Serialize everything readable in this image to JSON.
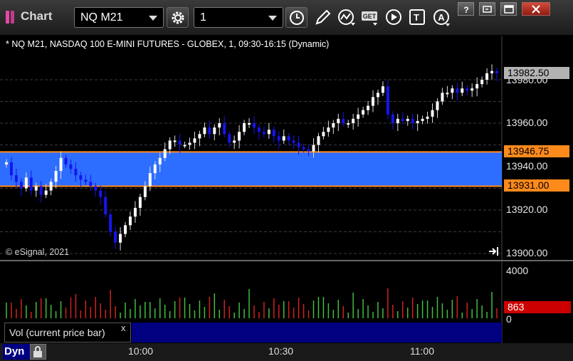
{
  "window": {
    "title": "Chart",
    "symbol": "NQ M21",
    "interval": "1"
  },
  "toolbar": {
    "icons": [
      "settings-gear-icon",
      "clock-icon",
      "pencil-icon",
      "studies-icon",
      "get-icon",
      "play-icon",
      "text-tool-icon",
      "alert-icon"
    ],
    "get_label": "GET",
    "text_tool_label": "T",
    "alert_label": "A"
  },
  "window_controls": [
    "help-icon",
    "restore-icon",
    "maximize-icon",
    "close-icon"
  ],
  "chart": {
    "header": "* NQ M21, NASDAQ 100 E-MINI FUTURES - GLOBEX, 1, 09:30-16:15 (Dynamic)",
    "copyright": "© eSignal, 2021",
    "last_price": "13982.50",
    "upper_line": "13946.75",
    "lower_line": "13931.00",
    "price_axis": [
      "13980.00",
      "13960.00",
      "13940.00",
      "13920.00",
      "13900.00"
    ],
    "up_color": "#ffffff",
    "down_color": "#1515ee",
    "band_color": "#2d6dff",
    "line_color": "#ff8a1c"
  },
  "volume": {
    "legend": "Vol (current price bar)",
    "close_symbol": "x",
    "axis_top": "4000",
    "axis_bottom": "0",
    "last_value": "863"
  },
  "bottom": {
    "dyn_label": "Dyn",
    "time_labels": [
      "10:00",
      "10:30",
      "11:00"
    ]
  },
  "chart_data": {
    "type": "candlestick",
    "time_labels": [
      "10:00",
      "10:30",
      "11:00"
    ],
    "y_axis": {
      "min": 13900,
      "max": 13980,
      "step": 20
    },
    "horizontal_lines": [
      13946.75,
      13931.0
    ],
    "last_price": 13982.5,
    "close": [
      13942,
      13936,
      13933,
      13930,
      13935,
      13929,
      13931,
      13927,
      13929,
      13933,
      13938,
      13944,
      13941,
      13939,
      13936,
      13934,
      13933,
      13931,
      13929,
      13926,
      13918,
      13910,
      13905,
      13909,
      13913,
      13917,
      13921,
      13926,
      13931,
      13937,
      13941,
      13944,
      13948,
      13952,
      13952,
      13950,
      13950,
      13951,
      13953,
      13955,
      13958,
      13955,
      13958,
      13960,
      13955,
      13951,
      13952,
      13956,
      13960,
      13960,
      13958,
      13956,
      13955,
      13957,
      13954,
      13952,
      13954,
      13952,
      13951,
      13949,
      13948,
      13947,
      13950,
      13954,
      13956,
      13958,
      13960,
      13962,
      13960,
      13960,
      13962,
      13964,
      13966,
      13968,
      13972,
      13974,
      13977,
      13964,
      13960,
      13962,
      13961,
      13962,
      13960,
      13961,
      13962,
      13963,
      13966,
      13970,
      13974,
      13974,
      13976,
      13974,
      13976,
      13975,
      13976,
      13978,
      13980,
      13983,
      13984,
      13983
    ],
    "volume_max": 4000,
    "volume_last": 863
  }
}
